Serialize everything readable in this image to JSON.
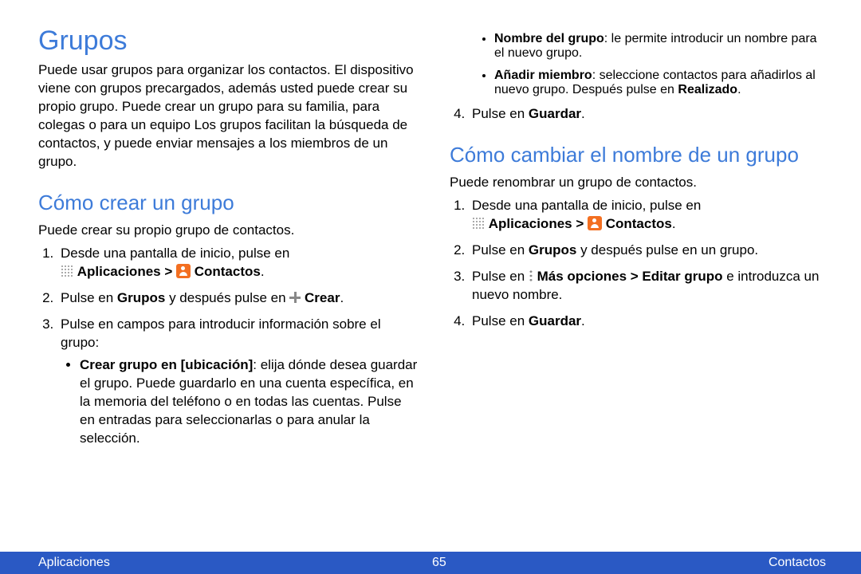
{
  "h1": "Grupos",
  "intro": "Puede usar grupos para organizar los contactos. El dispositivo viene con grupos precargados, además usted puede crear su propio grupo. Puede crear un grupo para su familia, para colegas o para un equipo Los grupos facilitan la búsqueda de contactos, y puede enviar mensajes a los miembros de un grupo.",
  "h2_create": "Cómo crear un grupo",
  "create_intro": "Puede crear su propio grupo de contactos.",
  "create": {
    "step1_pre": "Desde una pantalla de inicio, pulse en ",
    "apps_label": "Aplicaciones",
    "gt": " > ",
    "contacts_label": "Contactos",
    "period": ".",
    "step2_a": "Pulse en ",
    "step2_b": "Grupos",
    "step2_c": " y después pulse en ",
    "step2_d": "Crear",
    "step3": "Pulse en campos para introducir información sobre el grupo:",
    "sub1_label": "Crear grupo en [ubicación]",
    "sub1_rest": ": elija dónde desea guardar el grupo. Puede guardarlo en una cuenta específica, en la memoria del teléfono o en todas las cuentas. Pulse en entradas para seleccionarlas o para anular la selección.",
    "sub2_label": "Nombre del grupo",
    "sub2_rest": ": le permite introducir un nombre para el nuevo grupo.",
    "sub3_label": "Añadir miembro",
    "sub3_rest_a": ": seleccione contactos para añadirlos al nuevo grupo. Después pulse en ",
    "sub3_done": "Realizado",
    "step4_a": "Pulse en ",
    "step4_b": "Guardar"
  },
  "h2_rename": "Cómo cambiar el nombre de un grupo",
  "rename_intro": "Puede renombrar un grupo de contactos.",
  "rename": {
    "step1_pre": "Desde una pantalla de inicio, pulse en ",
    "step2_a": "Pulse en ",
    "step2_b": "Grupos",
    "step2_c": " y después pulse en un grupo.",
    "step3_a": "Pulse en ",
    "step3_b": "Más opciones",
    "step3_c": " > ",
    "step3_d": "Editar grupo",
    "step3_e": " e introduzca un nuevo nombre.",
    "step4_a": "Pulse en ",
    "step4_b": "Guardar"
  },
  "footer": {
    "left": "Aplicaciones",
    "page": "65",
    "right": "Contactos"
  }
}
